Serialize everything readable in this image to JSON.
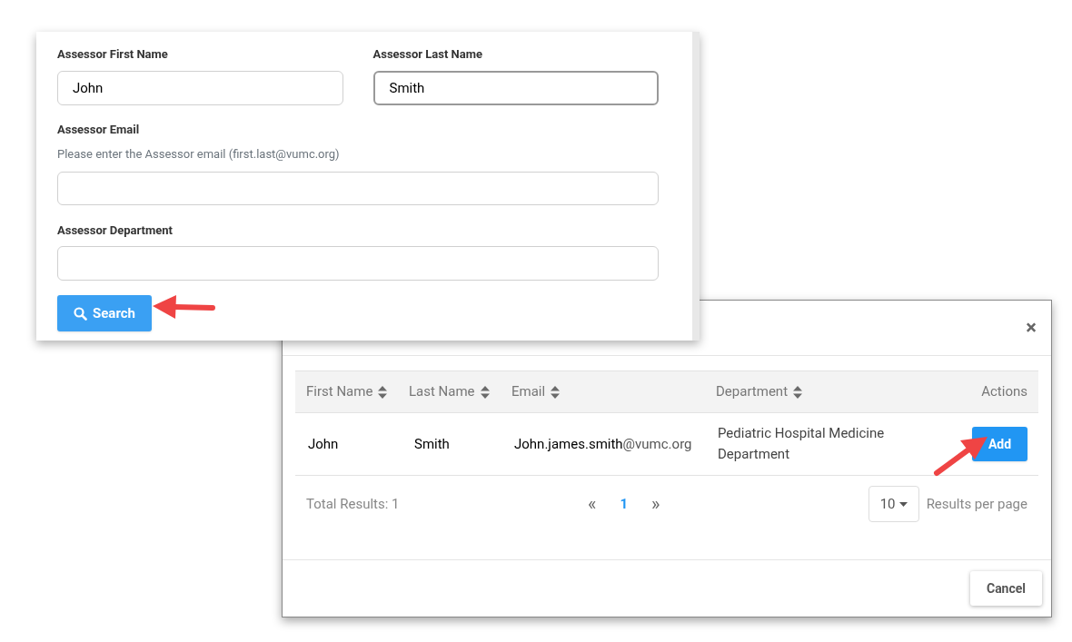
{
  "form": {
    "fields": [
      {
        "label": "Assessor First Name",
        "value": "John",
        "focused": false
      },
      {
        "label": "Assessor Last Name",
        "value": "Smith",
        "focused": true
      }
    ],
    "email": {
      "label": "Assessor Email",
      "help": "Please enter the Assessor email (first.last@vumc.org)"
    },
    "department": {
      "label": "Assessor Department"
    },
    "search_button": "Search"
  },
  "dialog": {
    "close": "×",
    "table": {
      "columns": [
        {
          "label": "First Name",
          "sortable": true
        },
        {
          "label": "Last Name",
          "sortable": true
        },
        {
          "label": "Email",
          "sortable": true
        },
        {
          "label": "Department",
          "sortable": true
        },
        {
          "label": "Actions",
          "sortable": false
        }
      ],
      "rows": [
        {
          "first_name": "John",
          "last_name": "Smith",
          "email_user": "John.james.smith",
          "email_domain": "@vumc.org",
          "department": "Pediatric Hospital Medicine Department",
          "action": "Add"
        }
      ]
    },
    "total": "Total Results: 1",
    "pager": {
      "prev": "«",
      "pages": [
        {
          "label": "1",
          "selected": true
        }
      ],
      "next": "»"
    },
    "per_page": {
      "value": "10",
      "label": "Results per page"
    },
    "cancel": "Cancel"
  }
}
